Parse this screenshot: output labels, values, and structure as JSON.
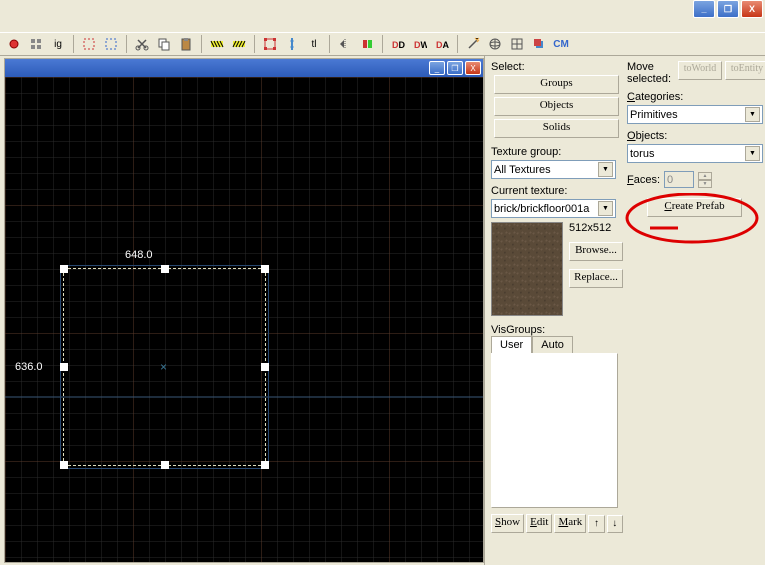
{
  "window_controls": {
    "min": "_",
    "max": "❐",
    "close": "X"
  },
  "toolbar": {
    "ig": "ig",
    "tl": "tl",
    "cm": "CM"
  },
  "viewport": {
    "dim_width": "648.0",
    "dim_height": "636.0"
  },
  "panel": {
    "select_label": "Select:",
    "groups_btn": "Groups",
    "objects_btn": "Objects",
    "solids_btn": "Solids",
    "texture_group_label": "Texture group:",
    "texture_group_value": "All Textures",
    "current_texture_label": "Current texture:",
    "current_texture_value": "brick/brickfloor001a",
    "texture_size": "512x512",
    "browse_btn": "Browse...",
    "replace_btn": "Replace...",
    "visgroups_label": "VisGroups:",
    "tabs": {
      "user": "User",
      "auto": "Auto"
    },
    "show_btn": "Show",
    "edit_btn": "Edit",
    "mark_btn": "Mark",
    "move_selected_label": "Move selected:",
    "toworld_btn": "toWorld",
    "toentity_btn": "toEntity",
    "categories_label": "Categories:",
    "categories_value": "Primitives",
    "objects_label": "Objects:",
    "objects_value": "torus",
    "faces_label": "Faces:",
    "faces_value": "0",
    "create_prefab_btn": "Create Prefab"
  }
}
